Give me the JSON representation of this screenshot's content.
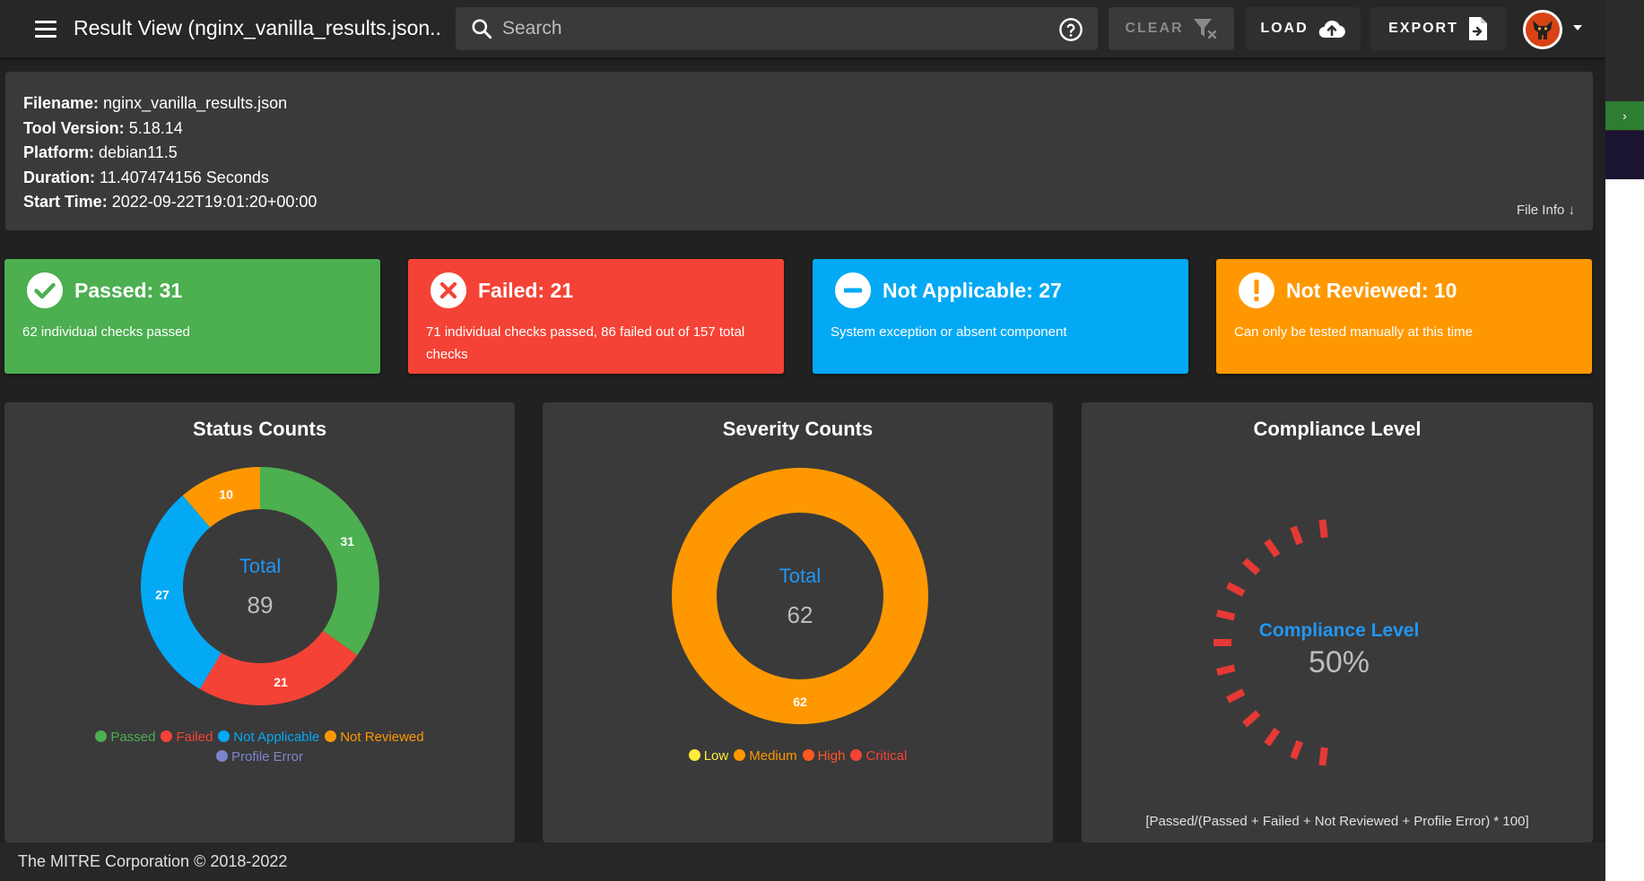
{
  "header": {
    "title": "Result View (nginx_vanilla_results.json...",
    "search_placeholder": "Search",
    "clear_label": "CLEAR",
    "load_label": "LOAD",
    "export_label": "EXPORT"
  },
  "file_info": {
    "rows": [
      {
        "label": "Filename:",
        "value": "nginx_vanilla_results.json"
      },
      {
        "label": "Tool Version:",
        "value": "5.18.14"
      },
      {
        "label": "Platform:",
        "value": "debian11.5"
      },
      {
        "label": "Duration:",
        "value": "11.407474156 Seconds"
      },
      {
        "label": "Start Time:",
        "value": "2022-09-22T19:01:20+00:00"
      }
    ],
    "toggle_label": "File Info ↓"
  },
  "cards": {
    "passed": {
      "title": "Passed: 31",
      "desc": "62 individual checks passed",
      "color": "#4caf50"
    },
    "failed": {
      "title": "Failed: 21",
      "desc": "71 individual checks passed, 86 failed out of 157 total checks",
      "color": "#f44336"
    },
    "not_applicable": {
      "title": "Not Applicable: 27",
      "desc": "System exception or absent component",
      "color": "#03a9f4"
    },
    "not_reviewed": {
      "title": "Not Reviewed: 10",
      "desc": "Can only be tested manually at this time",
      "color": "#ff9800"
    }
  },
  "status_counts": {
    "title": "Status Counts",
    "center_label": "Total",
    "center_value": "89",
    "legend": [
      {
        "name": "Passed",
        "color": "#4caf50"
      },
      {
        "name": "Failed",
        "color": "#f44336"
      },
      {
        "name": "Not Applicable",
        "color": "#03a9f4"
      },
      {
        "name": "Not Reviewed",
        "color": "#ff9800"
      },
      {
        "name": "Profile Error",
        "color": "#7986cb"
      }
    ]
  },
  "severity_counts": {
    "title": "Severity Counts",
    "center_label": "Total",
    "center_value": "62",
    "legend": [
      {
        "name": "Low",
        "color": "#ffeb3b"
      },
      {
        "name": "Medium",
        "color": "#ff9800"
      },
      {
        "name": "High",
        "color": "#ff5722"
      },
      {
        "name": "Critical",
        "color": "#f44336"
      }
    ]
  },
  "compliance": {
    "title": "Compliance Level",
    "label": "Compliance Level",
    "value_text": "50%",
    "value": 50,
    "formula": "[Passed/(Passed + Failed + Not Reviewed + Profile Error) * 100]",
    "color": "#e53935"
  },
  "footer": {
    "text": "The MITRE Corporation © 2018-2022"
  },
  "side_strip": {
    "arrow": "›"
  },
  "chart_data": [
    {
      "type": "pie",
      "title": "Status Counts",
      "categories": [
        "Passed",
        "Failed",
        "Not Applicable",
        "Not Reviewed",
        "Profile Error"
      ],
      "values": [
        31,
        21,
        27,
        10,
        0
      ],
      "colors": [
        "#4caf50",
        "#f44336",
        "#03a9f4",
        "#ff9800",
        "#7986cb"
      ],
      "donut": true,
      "total": 89
    },
    {
      "type": "pie",
      "title": "Severity Counts",
      "categories": [
        "Low",
        "Medium",
        "High",
        "Critical"
      ],
      "values": [
        0,
        62,
        0,
        0
      ],
      "colors": [
        "#ffeb3b",
        "#ff9800",
        "#ff5722",
        "#f44336"
      ],
      "donut": true,
      "total": 62
    }
  ]
}
